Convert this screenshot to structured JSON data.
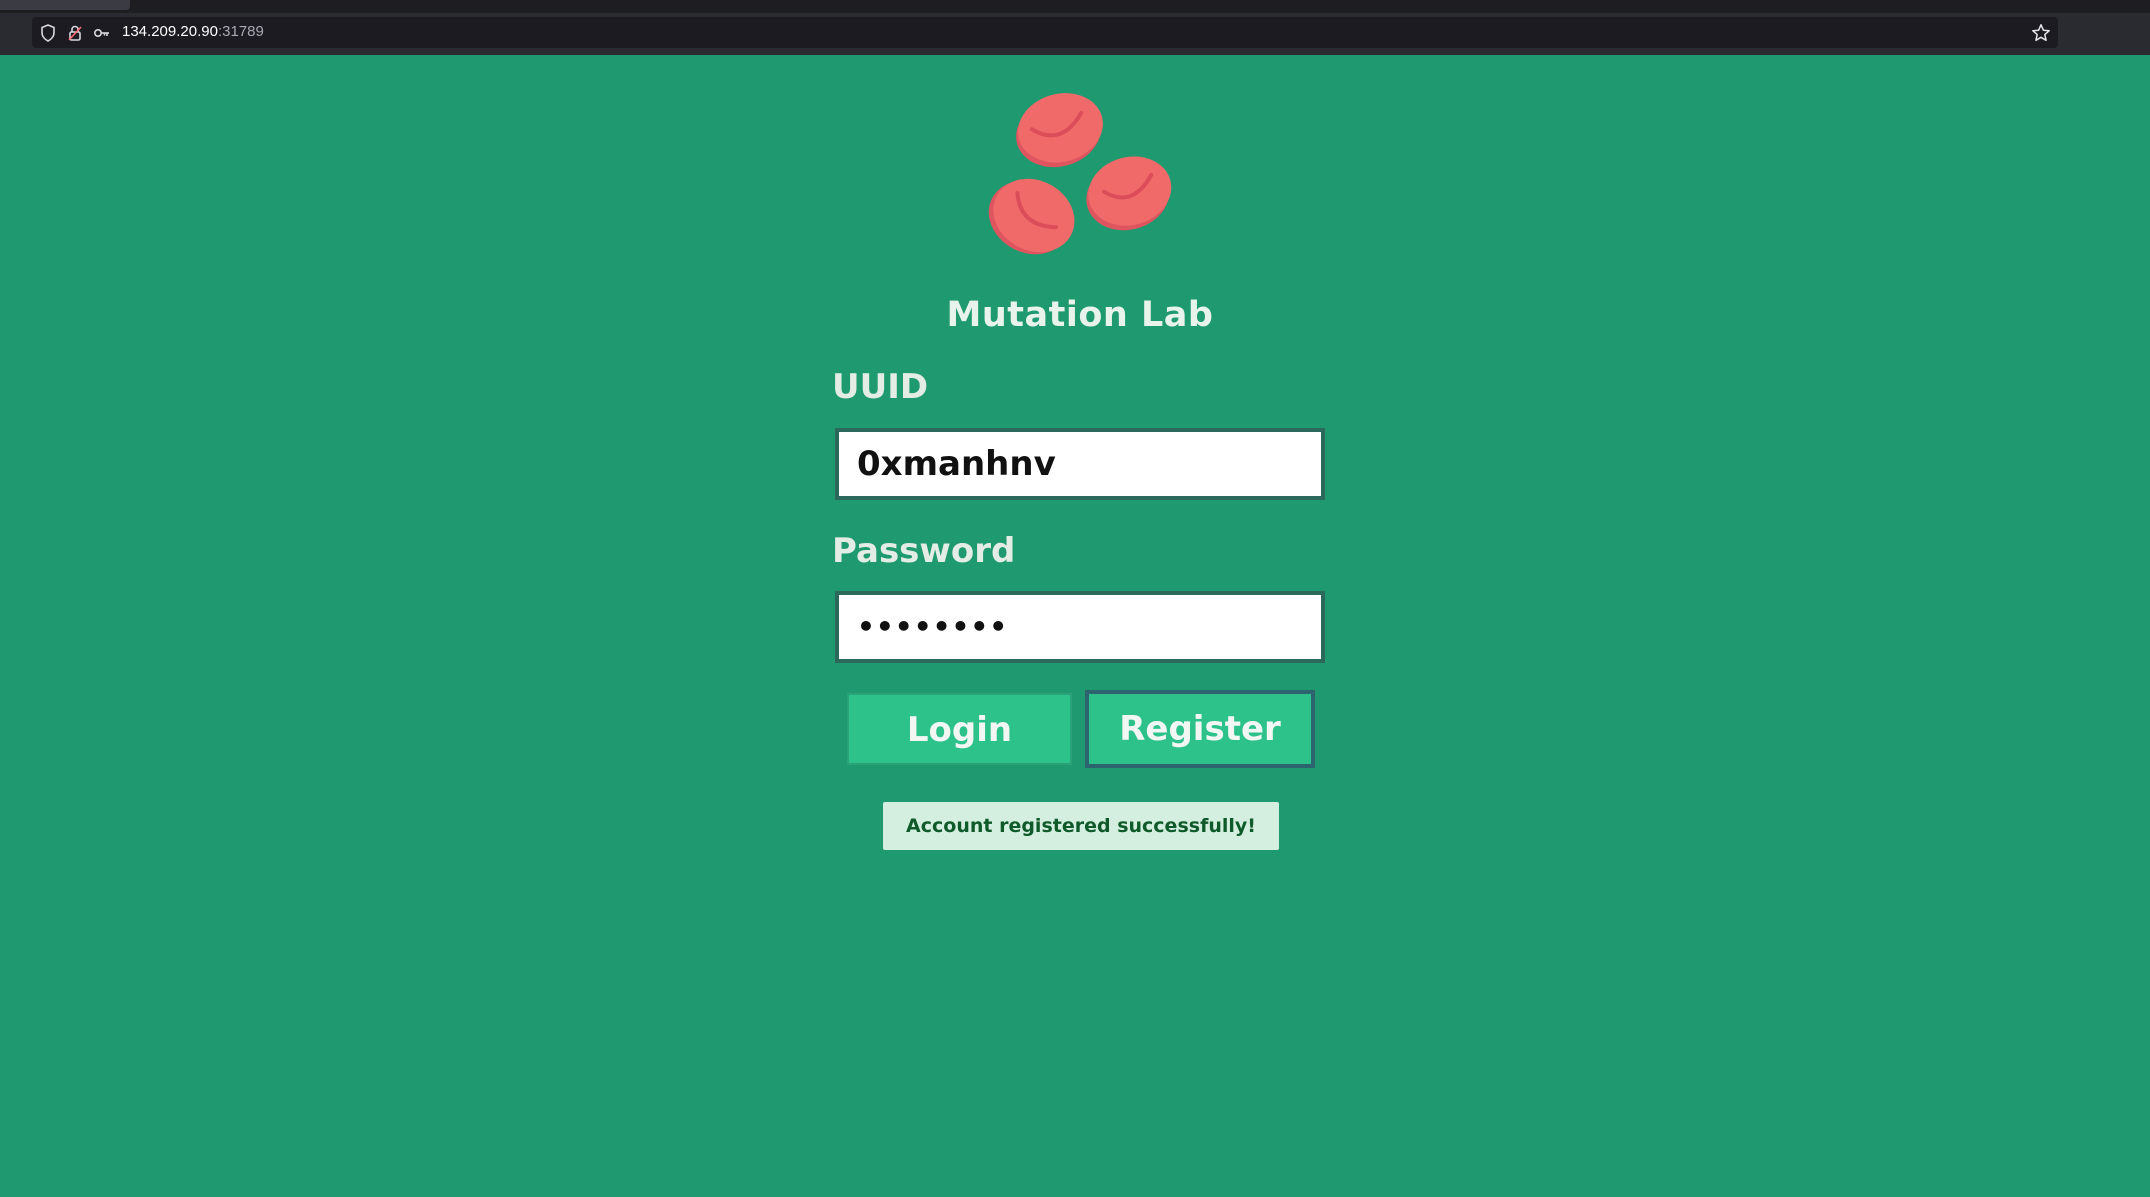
{
  "browser": {
    "url_host": "134.209.20.90",
    "url_port": ":31789"
  },
  "app": {
    "title": "Mutation Lab"
  },
  "form": {
    "uuid_label": "UUID",
    "uuid_value": "0xmanhnv",
    "password_label": "Password",
    "password_value": "••••••••",
    "login_label": "Login",
    "register_label": "Register"
  },
  "notice": {
    "message": "Account registered successfully!"
  },
  "colors": {
    "page_background": "#1f9a70",
    "button": "#2ec28b",
    "cell_red": "#f06a6a",
    "notice_background": "#d4efdf",
    "notice_text": "#0f5a2a"
  }
}
